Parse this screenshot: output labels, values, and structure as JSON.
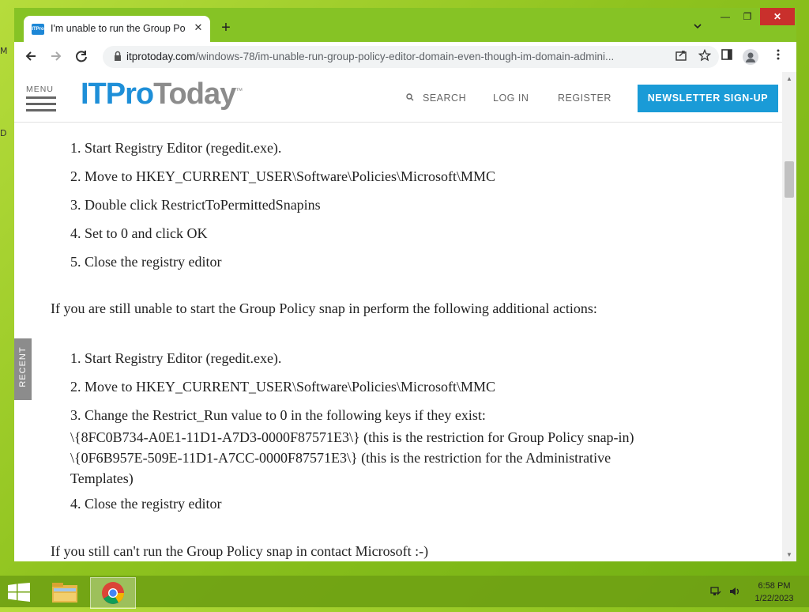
{
  "desktop": {
    "left_marks": [
      "M",
      "D"
    ]
  },
  "browser": {
    "tab": {
      "favicon": "ITPro",
      "title": "I'm unable to run the Group Policy Editor",
      "close": "✕"
    },
    "new_tab": "+",
    "window_buttons": {
      "minimize": "—",
      "maximize": "❐",
      "close": "✕"
    },
    "url_host": "itprotoday.com",
    "url_path": "/windows-78/im-unable-run-group-policy-editor-domain-even-though-im-domain-admini...",
    "icons": [
      "back-icon",
      "forward-icon",
      "reload-icon",
      "lock-icon",
      "share-icon",
      "star-icon",
      "side-panel-icon",
      "profile-icon",
      "more-icon"
    ]
  },
  "site": {
    "menu_label": "MENU",
    "logo_a": "ITPro",
    "logo_b": "Today",
    "logo_tm": "™",
    "search": "SEARCH",
    "login": "LOG IN",
    "register": "REGISTER",
    "newsletter": "NEWSLETTER SIGN-UP",
    "recent": "RECENT"
  },
  "article": {
    "list1": [
      "1. Start Registry Editor (regedit.exe).",
      "2. Move to HKEY_CURRENT_USER\\Software\\Policies\\Microsoft\\MMC",
      "3. Double click RestrictToPermittedSnapins",
      "4. Set to 0 and click OK",
      "5. Close the registry editor"
    ],
    "para1": "If you are still unable to start the Group Policy snap in perform the following additional actions:",
    "list2_1": "1. Start Registry Editor (regedit.exe).",
    "list2_2": "2. Move to HKEY_CURRENT_USER\\Software\\Policies\\Microsoft\\MMC",
    "list2_3a": "3. Change the Restrict_Run value to 0 in the following keys if they exist:",
    "list2_3b": "\\{8FC0B734-A0E1-11D1-A7D3-0000F87571E3\\} (this is the restriction for Group Policy snap-in)",
    "list2_3c": "\\{0F6B957E-509E-11D1-A7CC-0000F87571E3\\} (this is the restriction for the Administrative",
    "list2_3d": "Templates)",
    "list2_4": "4. Close the registry editor",
    "para2": "If you still can't run the Group Policy snap in contact Microsoft :-)"
  },
  "taskbar": {
    "apps": [
      "file-explorer-icon",
      "chrome-icon"
    ],
    "time": "6:58 PM",
    "date": "1/22/2023"
  }
}
